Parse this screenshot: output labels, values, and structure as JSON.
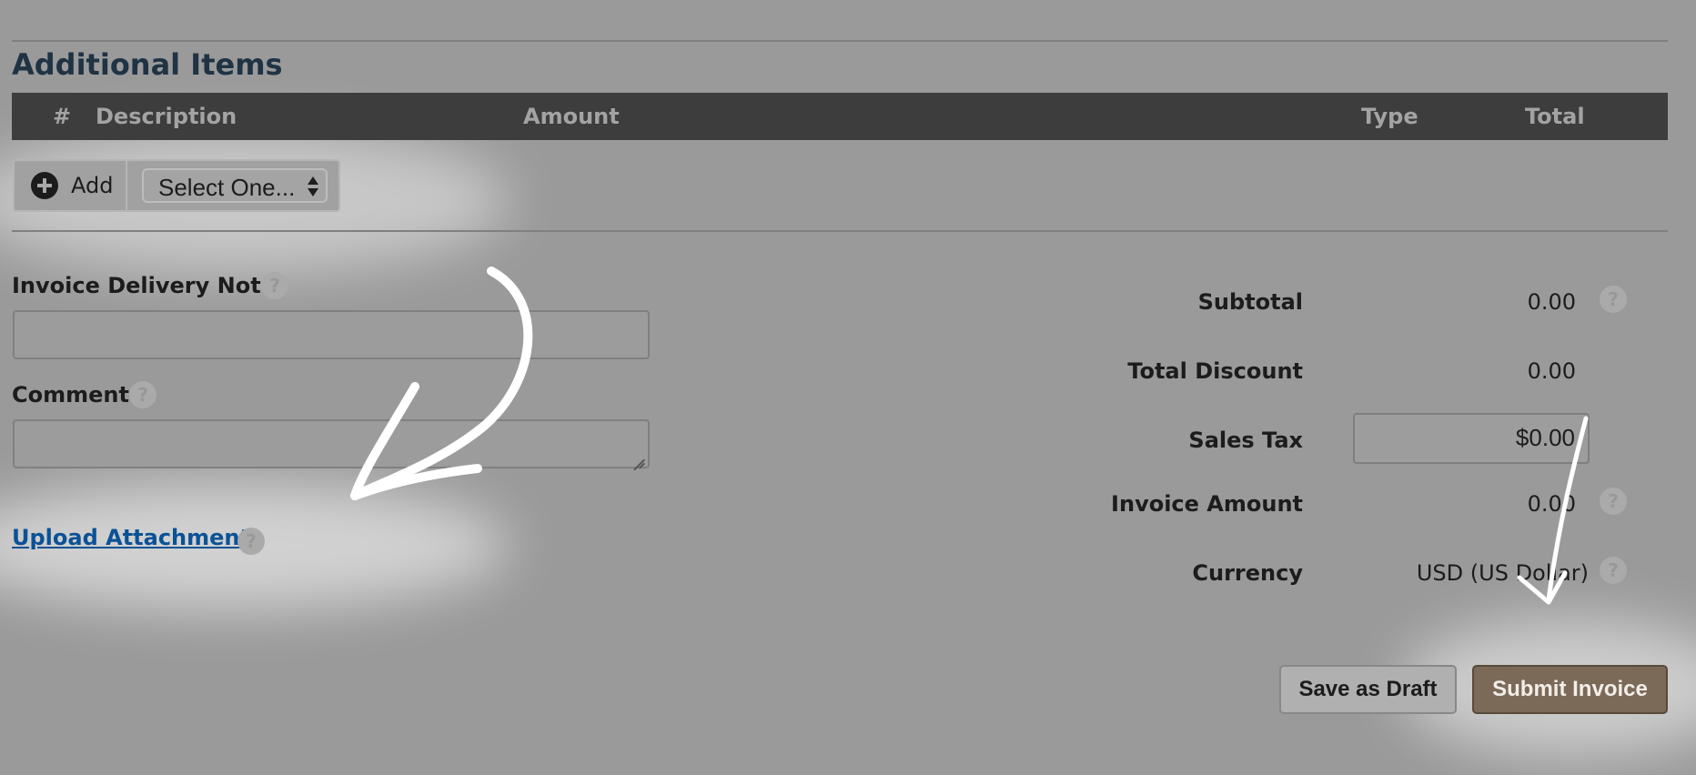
{
  "section": {
    "title": "Additional Items"
  },
  "table": {
    "headers": {
      "number": "#",
      "description": "Description",
      "amount": "Amount",
      "type": "Type",
      "total": "Total"
    }
  },
  "add_row": {
    "add_label": "Add",
    "select_value": "Select One..."
  },
  "form": {
    "delivery_note_label": "Invoice Delivery Note",
    "delivery_note_value": "",
    "comment_label": "Comment",
    "comment_value": "",
    "upload_link": "Upload Attachment",
    "help_glyph": "?"
  },
  "summary": {
    "subtotal_label": "Subtotal",
    "subtotal_value": "0.00",
    "discount_label": "Total Discount",
    "discount_value": "0.00",
    "tax_label": "Sales Tax",
    "tax_value": "$0.00",
    "invoice_amount_label": "Invoice Amount",
    "invoice_amount_value": "0.00",
    "currency_label": "Currency",
    "currency_value": "USD (US Dollar)"
  },
  "actions": {
    "save_draft": "Save as Draft",
    "submit": "Submit Invoice"
  },
  "colors": {
    "background": "#9a9a9a",
    "header_bar": "#3d3d3d",
    "link": "#0b5296",
    "submit_button": "#7c6a58",
    "title": "#1f3344"
  },
  "icons": [
    "plus-circle-icon",
    "up-down-arrows-icon",
    "help-icon",
    "resize-handle-icon",
    "arrow-annotation-icon"
  ]
}
